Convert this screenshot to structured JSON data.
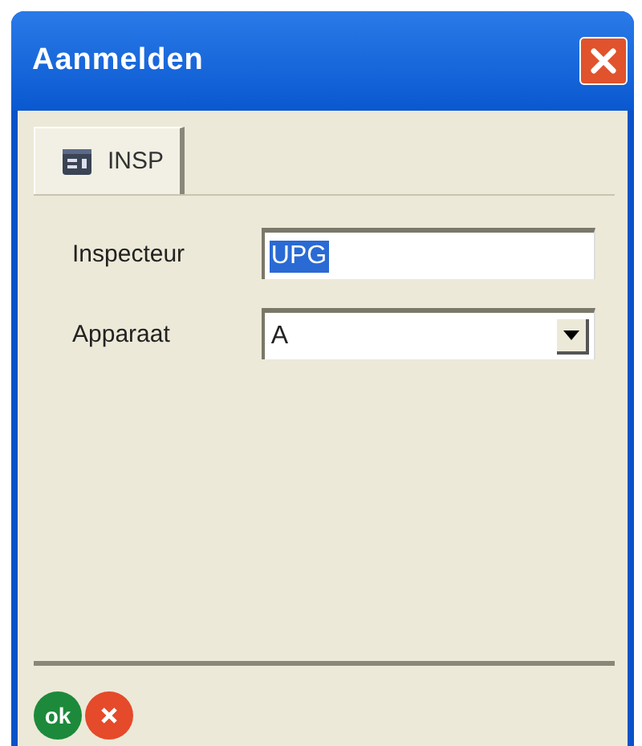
{
  "window": {
    "title": "Aanmelden"
  },
  "tabs": [
    {
      "label": "INSP",
      "selected": true
    }
  ],
  "fields": [
    {
      "kind": "text",
      "label": "Inspecteur",
      "value": "UPG",
      "text_selected": true
    },
    {
      "kind": "dropdown",
      "label": "Apparaat",
      "value": "A",
      "text_selected": false
    }
  ],
  "buttons": [
    {
      "kind": "ok",
      "label": "ok"
    },
    {
      "kind": "cancel"
    }
  ]
}
